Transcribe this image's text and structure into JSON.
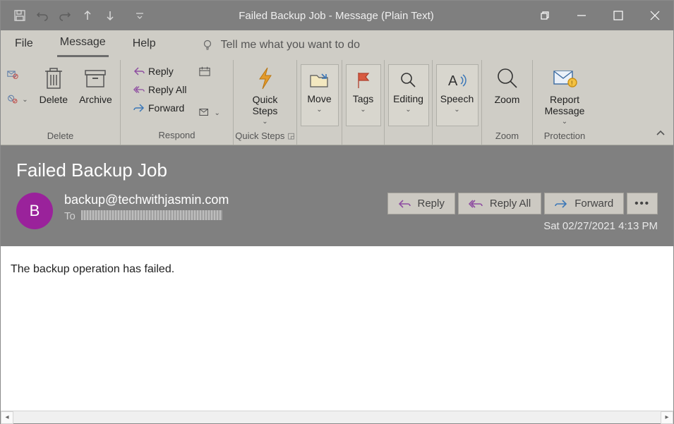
{
  "window": {
    "title_left": "Failed Backup Job",
    "title_sep": "  -  ",
    "title_right": "Message (Plain Text)"
  },
  "menu": {
    "file": "File",
    "message": "Message",
    "help": "Help",
    "tellme": "Tell me what you want to do"
  },
  "ribbon": {
    "delete": {
      "delete": "Delete",
      "archive": "Archive",
      "group": "Delete"
    },
    "respond": {
      "reply": "Reply",
      "replyall": "Reply All",
      "forward": "Forward",
      "group": "Respond"
    },
    "quicksteps": {
      "label": "Quick\nSteps",
      "group": "Quick Steps"
    },
    "move": {
      "label": "Move",
      "group": ""
    },
    "tags": {
      "label": "Tags",
      "group": ""
    },
    "editing": {
      "label": "Editing",
      "group": ""
    },
    "speech": {
      "label": "Speech",
      "group": ""
    },
    "zoom": {
      "label": "Zoom",
      "group": "Zoom"
    },
    "protection": {
      "label": "Report\nMessage",
      "group": "Protection"
    }
  },
  "message": {
    "subject": "Failed Backup Job",
    "avatar_initial": "B",
    "from": "backup@techwithjasmin.com",
    "to_label": "To",
    "date": "Sat 02/27/2021 4:13 PM",
    "body": "The backup operation has failed."
  },
  "actions": {
    "reply": "Reply",
    "replyall": "Reply All",
    "forward": "Forward",
    "more": "•••"
  }
}
